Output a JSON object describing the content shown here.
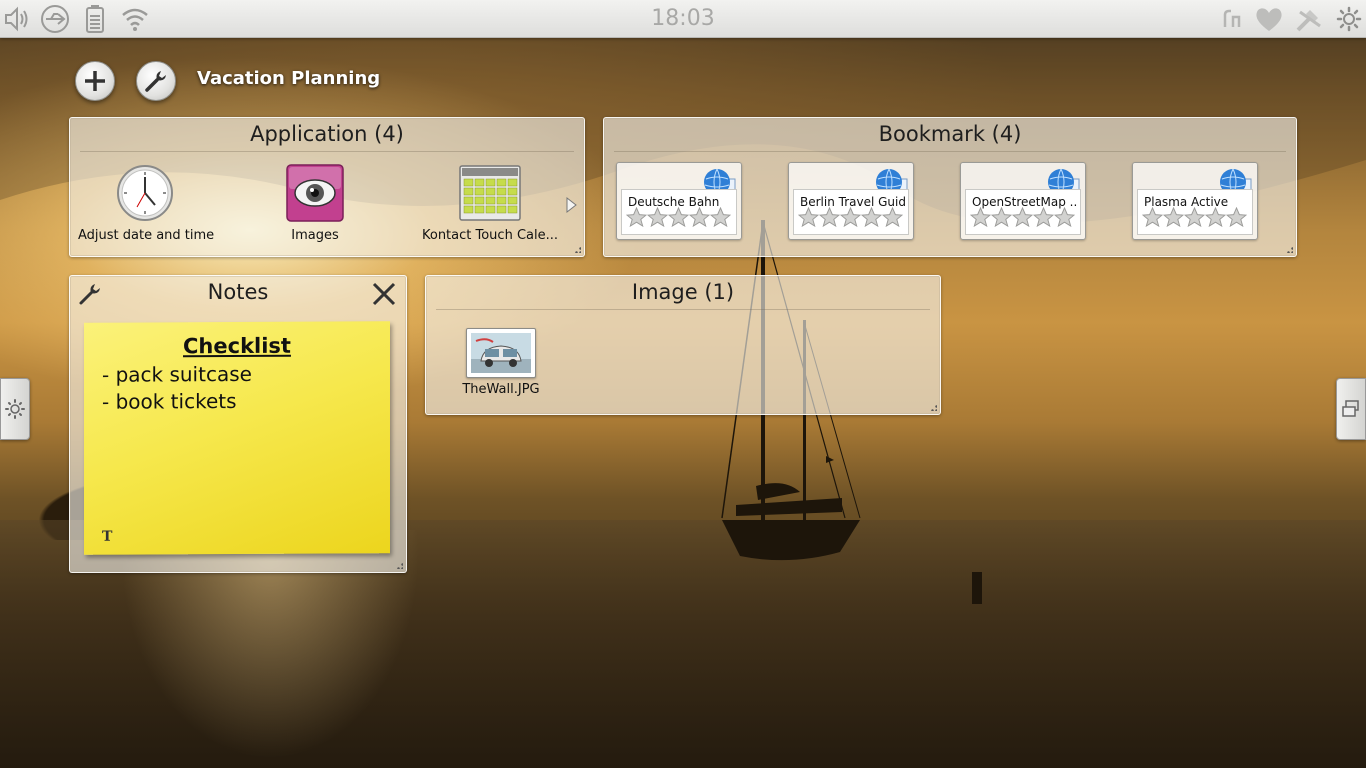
{
  "panel": {
    "clock": "18:03",
    "left_icons": [
      "volume-icon",
      "usb-icon",
      "battery-icon",
      "wifi-icon"
    ],
    "right_icons": [
      "keyboard-icon",
      "heart-icon",
      "tools-icon",
      "settings-gear-icon"
    ]
  },
  "activity": {
    "title": "Vacation Planning",
    "add_icon": "plus-icon",
    "configure_icon": "wrench-icon"
  },
  "widgets": {
    "application": {
      "title": "Application (4)",
      "items": [
        {
          "label": "Adjust date and time",
          "icon": "clock-icon"
        },
        {
          "label": "Images",
          "icon": "image-viewer-eye-icon"
        },
        {
          "label": "Kontact Touch Cale...",
          "icon": "calendar-icon"
        }
      ],
      "next_icon": "arrow-right-icon"
    },
    "bookmark": {
      "title": "Bookmark (4)",
      "items": [
        {
          "label": "Deutsche Bahn",
          "rating": 0
        },
        {
          "label": "Berlin Travel Guide",
          "rating": 0
        },
        {
          "label": "OpenStreetMap ...",
          "rating": 0
        },
        {
          "label": "Plasma Active",
          "rating": 0
        }
      ],
      "max_rating": 5
    },
    "notes": {
      "title": "Notes",
      "heading": "Checklist",
      "lines": [
        "- pack suitcase",
        "- book tickets"
      ],
      "format_glyph": "T"
    },
    "image": {
      "title": "Image (1)",
      "items": [
        {
          "label": "TheWall.JPG"
        }
      ]
    }
  },
  "colors": {
    "note_yellow": "#f6e84d",
    "panel_bg": "#e8e8e6",
    "widget_bg": "#f5f3ee"
  }
}
